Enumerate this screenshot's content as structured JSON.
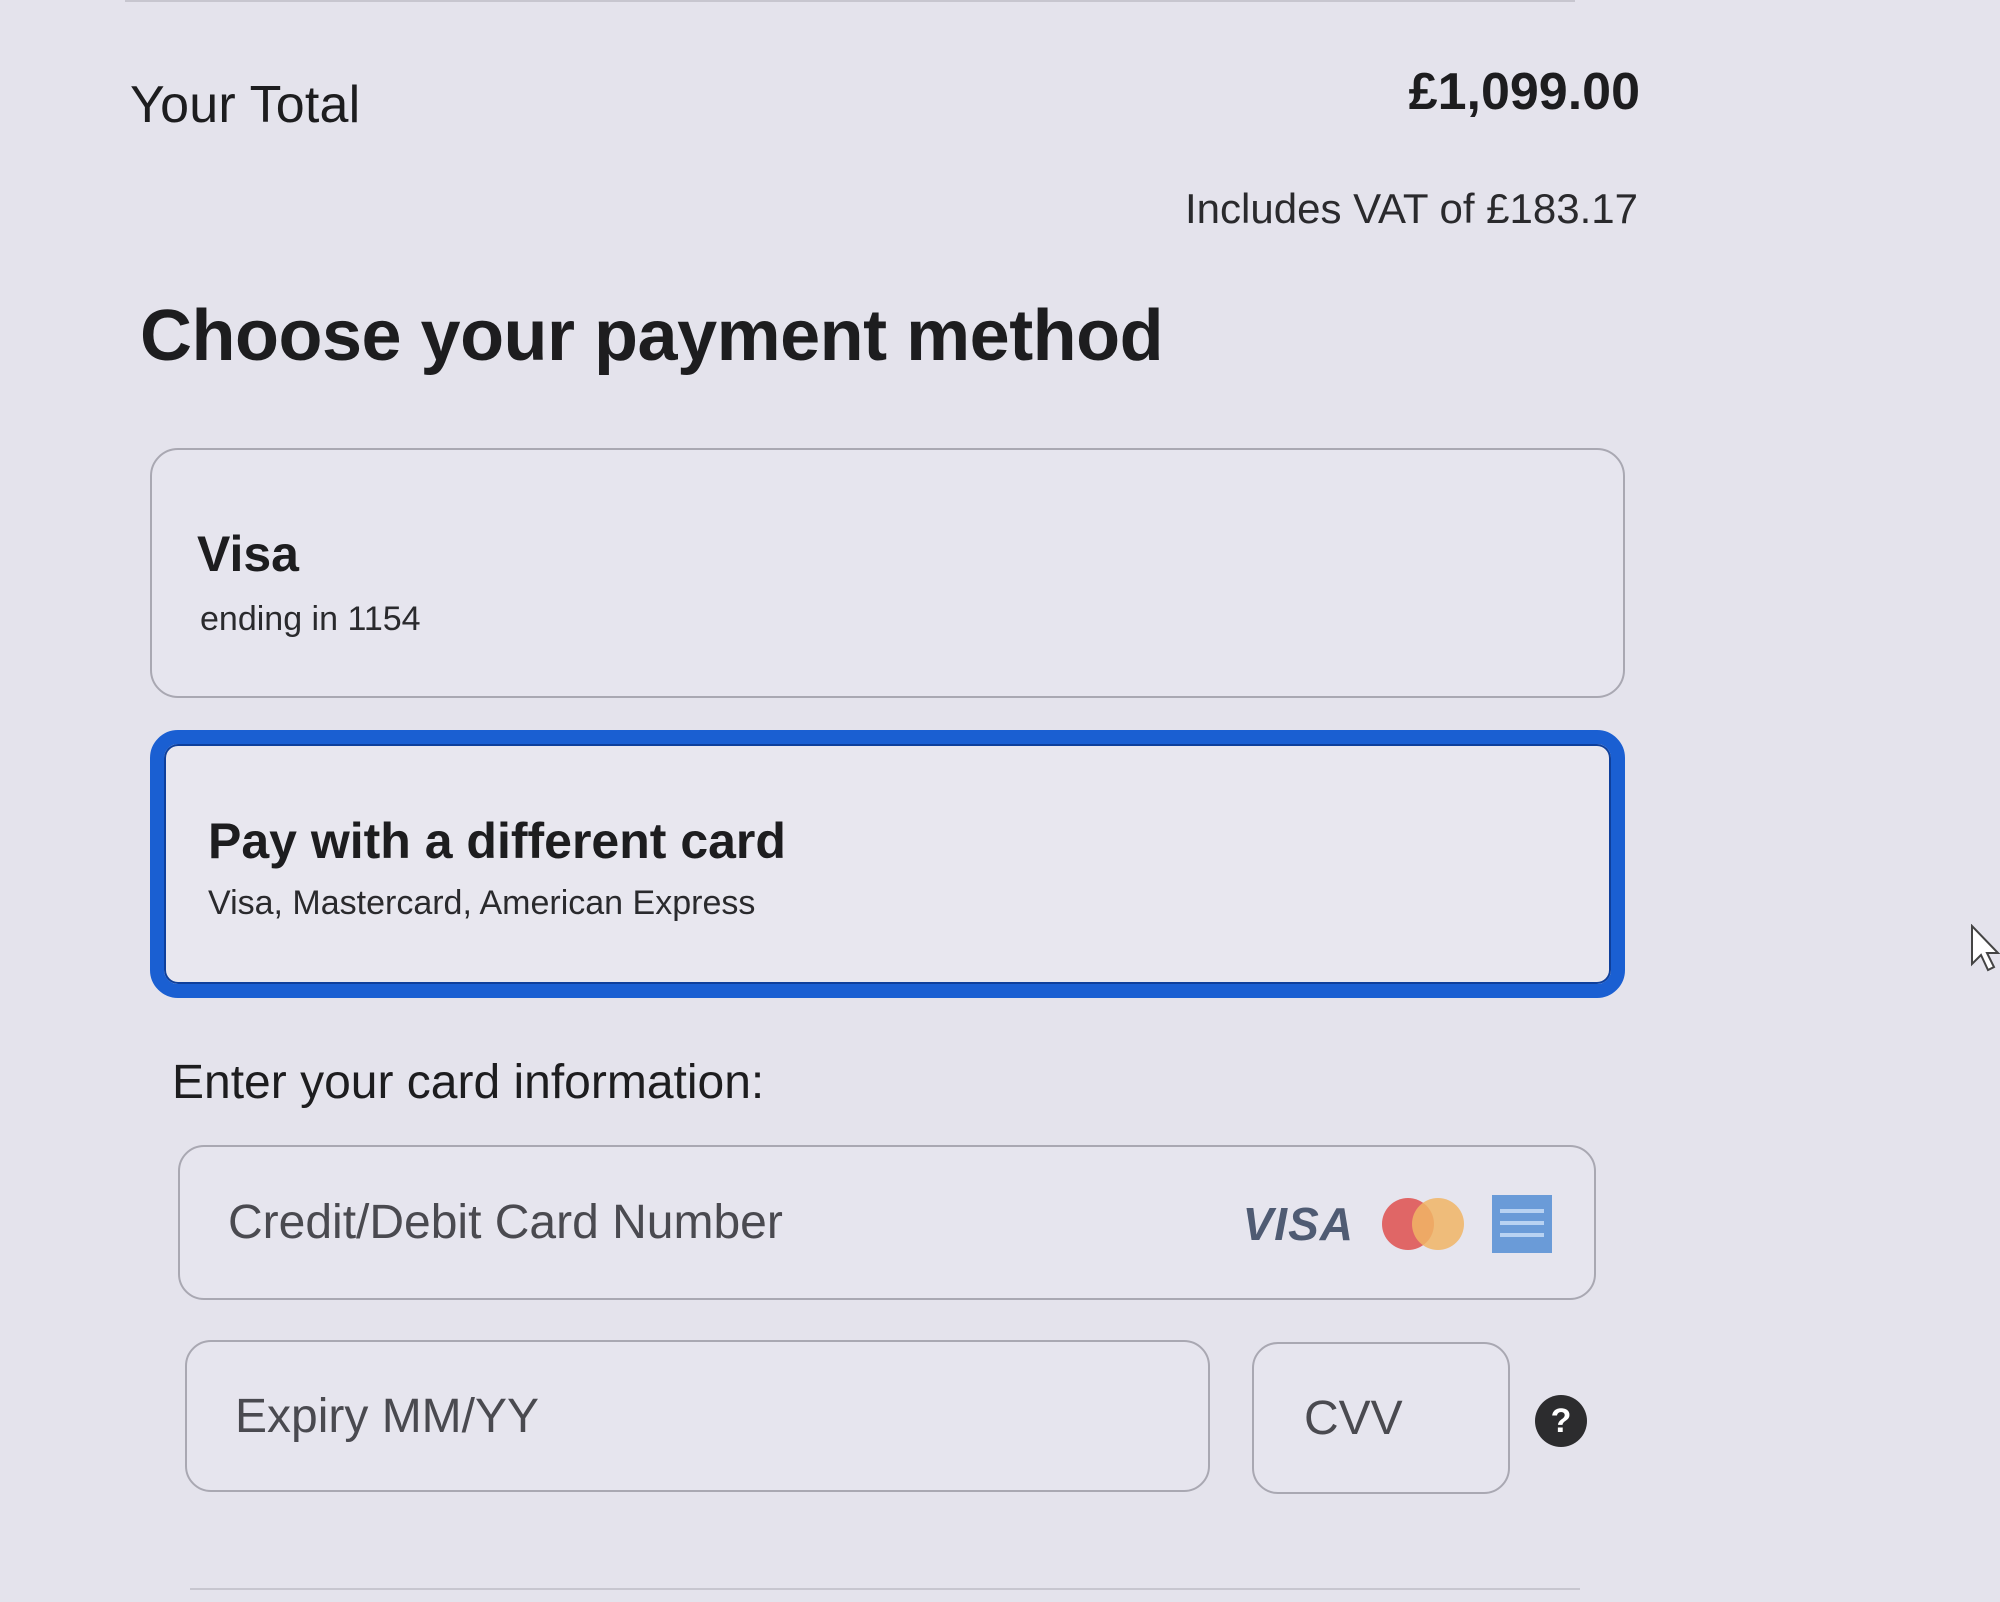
{
  "summary": {
    "total_label": "Your Total",
    "total_amount": "£1,099.00",
    "vat_note": "Includes VAT of £183.17"
  },
  "payment": {
    "heading": "Choose your payment method",
    "options": [
      {
        "title": "Visa",
        "subtitle": "ending in 1154",
        "selected": false
      },
      {
        "title": "Pay with a different card",
        "subtitle": "Visa, Mastercard, American Express",
        "selected": true
      }
    ],
    "selected_border_color": "#1a5fd2"
  },
  "card_form": {
    "label": "Enter your card information:",
    "card_number": {
      "value": "",
      "placeholder": "Credit/Debit Card Number"
    },
    "accepted_logos": [
      "visa-logo",
      "mastercard-logo",
      "amex-logo"
    ],
    "visa_logo_text": "VISA",
    "expiry": {
      "value": "",
      "placeholder": "Expiry MM/YY"
    },
    "cvv": {
      "value": "",
      "placeholder": "CVV"
    },
    "help_icon": "?"
  }
}
